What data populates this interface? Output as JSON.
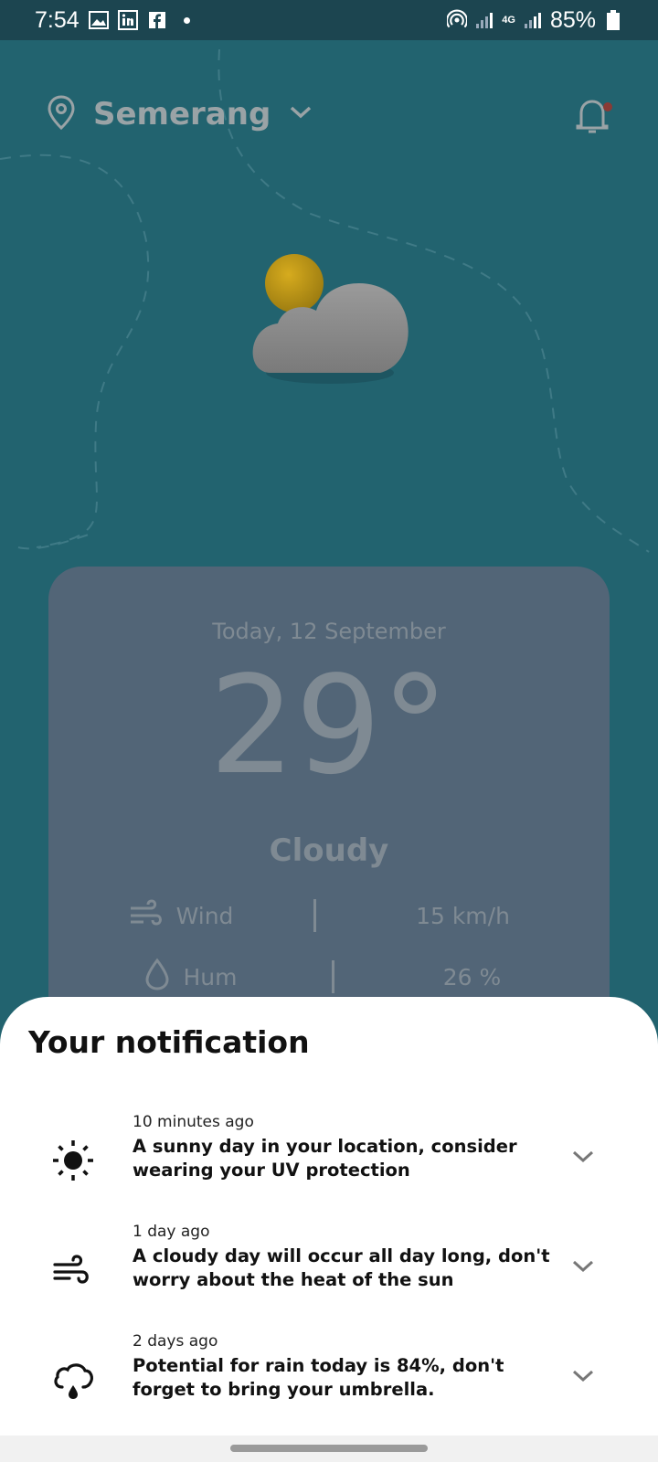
{
  "status_bar": {
    "time": "7:54",
    "battery": "85%",
    "network": "4G",
    "icons": [
      "gallery-icon",
      "linkedin-icon",
      "facebook-icon",
      "hotspot-icon",
      "signal-icon",
      "battery-icon"
    ]
  },
  "header": {
    "location": "Semerang"
  },
  "weather": {
    "date": "Today, 12 September",
    "temperature": "29°",
    "condition": "Cloudy",
    "wind_label": "Wind",
    "wind_value": "15 km/h",
    "hum_label": "Hum",
    "hum_value": "26 %"
  },
  "sheet": {
    "title": "Your notification",
    "items": [
      {
        "time": "10 minutes ago",
        "text": "A sunny day in your location, consider wearing your UV protection",
        "icon": "sun-icon"
      },
      {
        "time": "1 day ago",
        "text": "A cloudy day will occur all day long, don't worry about the heat of the sun",
        "icon": "wind-icon"
      },
      {
        "time": "2 days ago",
        "text": "Potential for rain today is 84%, don't forget to bring your umbrella.",
        "icon": "rain-cloud-icon"
      }
    ]
  },
  "colors": {
    "background": "#1f5966",
    "card": "#526577",
    "sheet": "#ffffff",
    "sun": "#b8941a"
  }
}
